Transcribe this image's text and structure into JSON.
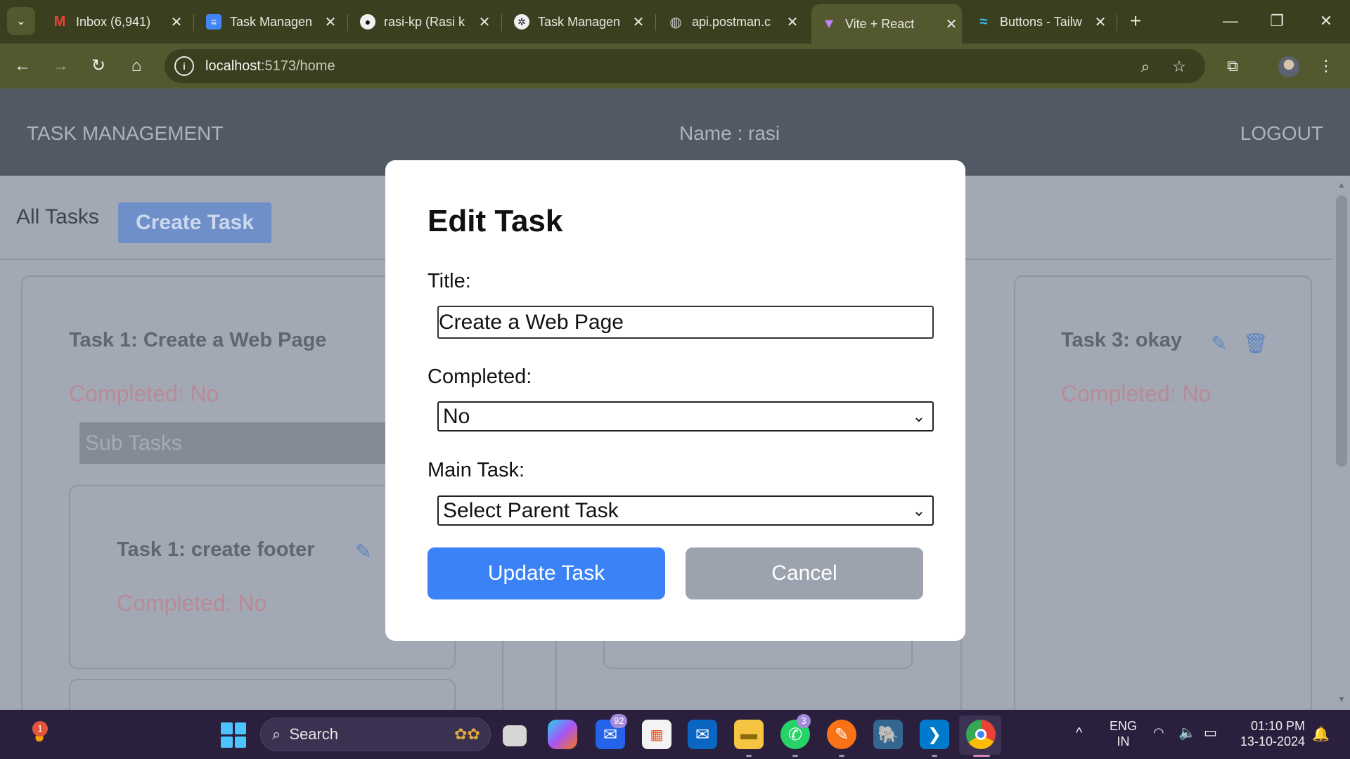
{
  "browser": {
    "tabs": [
      {
        "title": "Inbox (6,941)",
        "icon": "gmail-icon",
        "color": "#ea4335"
      },
      {
        "title": "Task Managen",
        "icon": "docs-icon",
        "color": "#4285f4"
      },
      {
        "title": "rasi-kp (Rasi k",
        "icon": "github-icon",
        "color": "#111111"
      },
      {
        "title": "Task Managen",
        "icon": "chatgpt-icon",
        "color": "#111111"
      },
      {
        "title": "api.postman.c",
        "icon": "globe-icon",
        "color": "#888888"
      },
      {
        "title": "Vite + React",
        "icon": "vite-icon",
        "color": "#a855f7"
      },
      {
        "title": "Buttons - Tailw",
        "icon": "tailwind-icon",
        "color": "#38bdf8"
      }
    ],
    "url_host": "localhost",
    "url_path": ":5173/home"
  },
  "app": {
    "brand": "TASK MANAGEMENT",
    "user_label": "Name : rasi",
    "logout": "LOGOUT",
    "all_tasks": "All Tasks",
    "create_task": "Create Task",
    "sub_tasks": "Sub Tasks",
    "tasks": [
      {
        "title": "Task 1: Create a Web Page",
        "status": "Completed: No"
      },
      {
        "title": "Task 3: okay",
        "status": "Completed: No"
      }
    ],
    "subtask": {
      "title": "Task 1: create footer",
      "status": "Completed: No"
    }
  },
  "modal": {
    "heading": "Edit Task",
    "title_label": "Title:",
    "title_value": "Create a Web Page",
    "completed_label": "Completed:",
    "completed_value": "No",
    "main_task_label": "Main Task:",
    "main_task_value": "Select Parent Task",
    "update_button": "Update Task",
    "cancel_button": "Cancel"
  },
  "taskbar": {
    "weather_badge": "1",
    "search_placeholder": "Search",
    "outlook_badge": "92",
    "whatsapp_badge": "3",
    "lang_top": "ENG",
    "lang_bottom": "IN",
    "time": "01:10 PM",
    "date": "13-10-2024"
  }
}
